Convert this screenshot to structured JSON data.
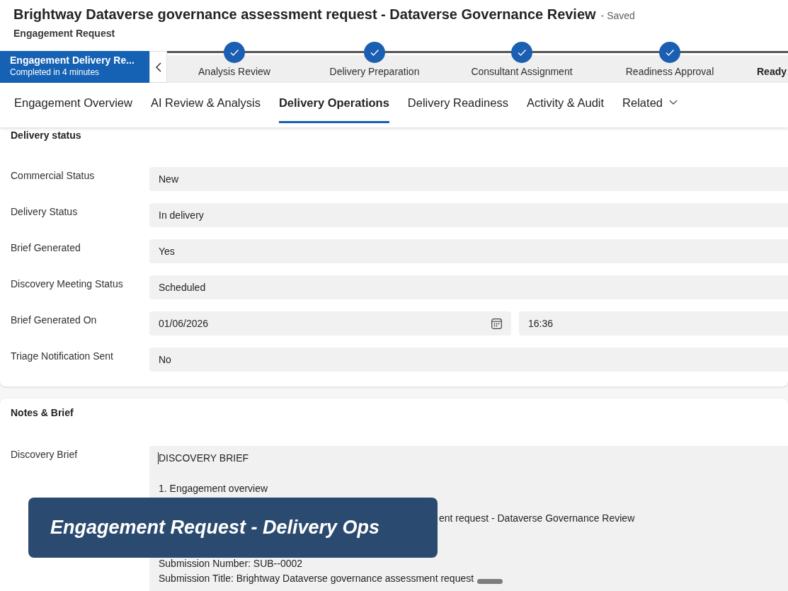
{
  "header": {
    "title": "Brightway Dataverse governance assessment request - Dataverse Governance Review",
    "save_status": "- Saved",
    "entity": "Engagement Request"
  },
  "process_bar": {
    "active_stage": {
      "name": "Engagement Delivery Re...",
      "subtitle": "Completed in 4 minutes"
    },
    "stages": [
      {
        "label": "Analysis Review",
        "completed": true,
        "selected": false
      },
      {
        "label": "Delivery Preparation",
        "completed": true,
        "selected": false
      },
      {
        "label": "Consultant Assignment",
        "completed": true,
        "selected": false
      },
      {
        "label": "Readiness Approval",
        "completed": true,
        "selected": false
      },
      {
        "label": "Ready",
        "completed": false,
        "selected": true
      }
    ]
  },
  "tabs": [
    {
      "label": "Engagement Overview",
      "kind": "tab",
      "selected": false
    },
    {
      "label": "AI Review & Analysis",
      "kind": "tab",
      "selected": false
    },
    {
      "label": "Delivery Operations",
      "kind": "tab",
      "selected": true
    },
    {
      "label": "Delivery Readiness",
      "kind": "tab",
      "selected": false
    },
    {
      "label": "Activity & Audit",
      "kind": "tab",
      "selected": false
    },
    {
      "label": "Related",
      "kind": "menu",
      "selected": false
    }
  ],
  "sections": [
    {
      "title": "Delivery status",
      "fields": [
        {
          "label": "Commercial Status",
          "kind": "text",
          "value": "New"
        },
        {
          "label": "Delivery Status",
          "kind": "text",
          "value": "In delivery"
        },
        {
          "label": "Brief Generated",
          "kind": "text",
          "value": "Yes"
        },
        {
          "label": "Discovery Meeting Status",
          "kind": "text",
          "value": "Scheduled"
        },
        {
          "label": "Brief Generated On",
          "kind": "datetime",
          "date": "01/06/2026",
          "time": "16:36"
        },
        {
          "label": "Triage Notification Sent",
          "kind": "text",
          "value": "No"
        }
      ]
    },
    {
      "title": "Notes & Brief",
      "fields": [
        {
          "label": "Discovery Brief",
          "kind": "multiline",
          "focused": true,
          "paragraphs_above_caption": [
            [
              "DISCOVERY BRIEF"
            ],
            [
              "1. Engagement overview"
            ]
          ],
          "line_beside_caption": "ent request - Dataverse Governance Review",
          "lines_below_caption": [
            "Submission Number: SUB--0002",
            "Submission Title: Brightway Dataverse governance assessment request"
          ]
        }
      ]
    }
  ],
  "caption": "Engagement Request - Delivery Ops"
}
